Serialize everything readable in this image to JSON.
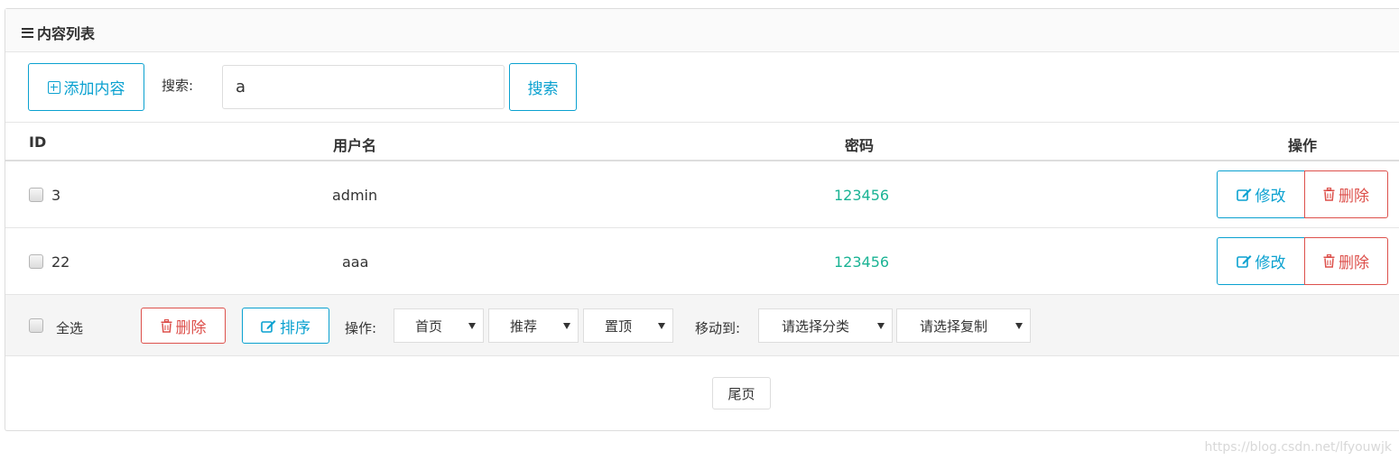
{
  "header": {
    "title": "内容列表",
    "menu_icon": "menu-icon"
  },
  "toolbar": {
    "add_label": "添加内容",
    "add_icon": "plus-square-icon",
    "search_label": "搜索:",
    "search_value": "a",
    "search_button": "搜索"
  },
  "table": {
    "headers": [
      "ID",
      "用户名",
      "密码",
      "操作"
    ],
    "rows": [
      {
        "id": "3",
        "username": "admin",
        "password": "123456",
        "edit": "修改",
        "delete": "删除"
      },
      {
        "id": "22",
        "username": "aaa",
        "password": "123456",
        "edit": "修改",
        "delete": "删除"
      }
    ]
  },
  "batch": {
    "select_all": "全选",
    "delete": "删除",
    "sort": "排序",
    "operation_label": "操作:",
    "op_selects": [
      "首页",
      "推荐",
      "置顶"
    ],
    "move_label": "移动到:",
    "category_select": "请选择分类",
    "copy_select": "请选择复制"
  },
  "pagination": {
    "last_page": "尾页"
  },
  "watermark": "https://blog.csdn.net/lfyouwjk",
  "colors": {
    "primary": "#0aa1d0",
    "danger": "#dd514c",
    "success": "#1ab394"
  }
}
